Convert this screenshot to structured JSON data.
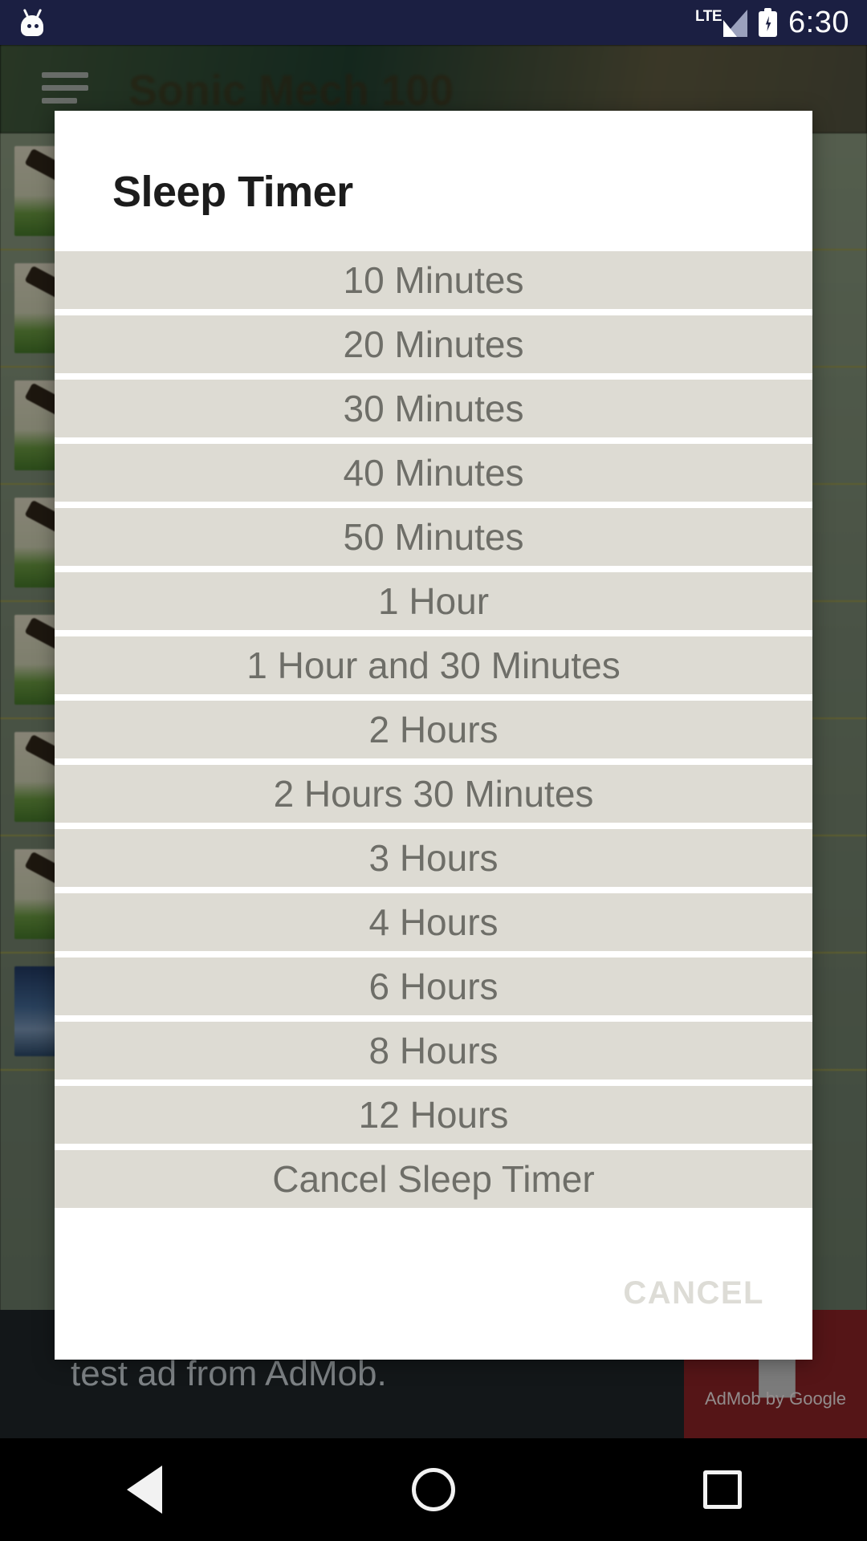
{
  "status_bar": {
    "notification_icon": "android-mascot-icon",
    "network_label": "LTE",
    "signal_icon": "signal-bars-icon",
    "battery_icon": "battery-charging-icon",
    "time": "6:30"
  },
  "background_app": {
    "menu_icon": "hamburger-menu-icon",
    "title": "Sonic Mech 100",
    "rows": [
      {
        "thumb": "stick-on-grass-thumbnail"
      },
      {
        "thumb": "stick-on-grass-thumbnail"
      },
      {
        "thumb": "stick-on-grass-thumbnail"
      },
      {
        "thumb": "stick-on-grass-thumbnail"
      },
      {
        "thumb": "stick-on-grass-thumbnail"
      },
      {
        "thumb": "stick-on-grass-thumbnail"
      },
      {
        "thumb": "stick-on-grass-thumbnail"
      },
      {
        "thumb": "lake-mountain-thumbnail"
      }
    ],
    "ad": {
      "text": "test ad from AdMob.",
      "badge_glyph": "▐▌",
      "badge_caption": "AdMob by Google"
    }
  },
  "dialog": {
    "title": "Sleep Timer",
    "options": [
      {
        "label": "10 Minutes"
      },
      {
        "label": "20 Minutes"
      },
      {
        "label": "30 Minutes"
      },
      {
        "label": "40 Minutes"
      },
      {
        "label": "50 Minutes"
      },
      {
        "label": "1 Hour"
      },
      {
        "label": "1 Hour and 30 Minutes"
      },
      {
        "label": "2 Hours"
      },
      {
        "label": "2 Hours 30 Minutes"
      },
      {
        "label": "3 Hours"
      },
      {
        "label": "4 Hours"
      },
      {
        "label": "6 Hours"
      },
      {
        "label": "8 Hours"
      },
      {
        "label": "12 Hours"
      },
      {
        "label": "Cancel Sleep Timer"
      }
    ],
    "cancel_label": "CANCEL"
  },
  "nav_bar": {
    "back_icon": "back-triangle-icon",
    "home_icon": "home-circle-icon",
    "recents_icon": "recents-square-icon"
  },
  "colors": {
    "status_bar_bg": "#1b1f42",
    "dialog_bg": "#ffffff",
    "option_bg": "#dddbd3",
    "option_text": "#6e6e68",
    "title_text": "#1c1c1c",
    "cancel_text": "#dddcd6",
    "nav_bar_bg": "#000000",
    "ad_badge_bg": "#7e1f22"
  }
}
